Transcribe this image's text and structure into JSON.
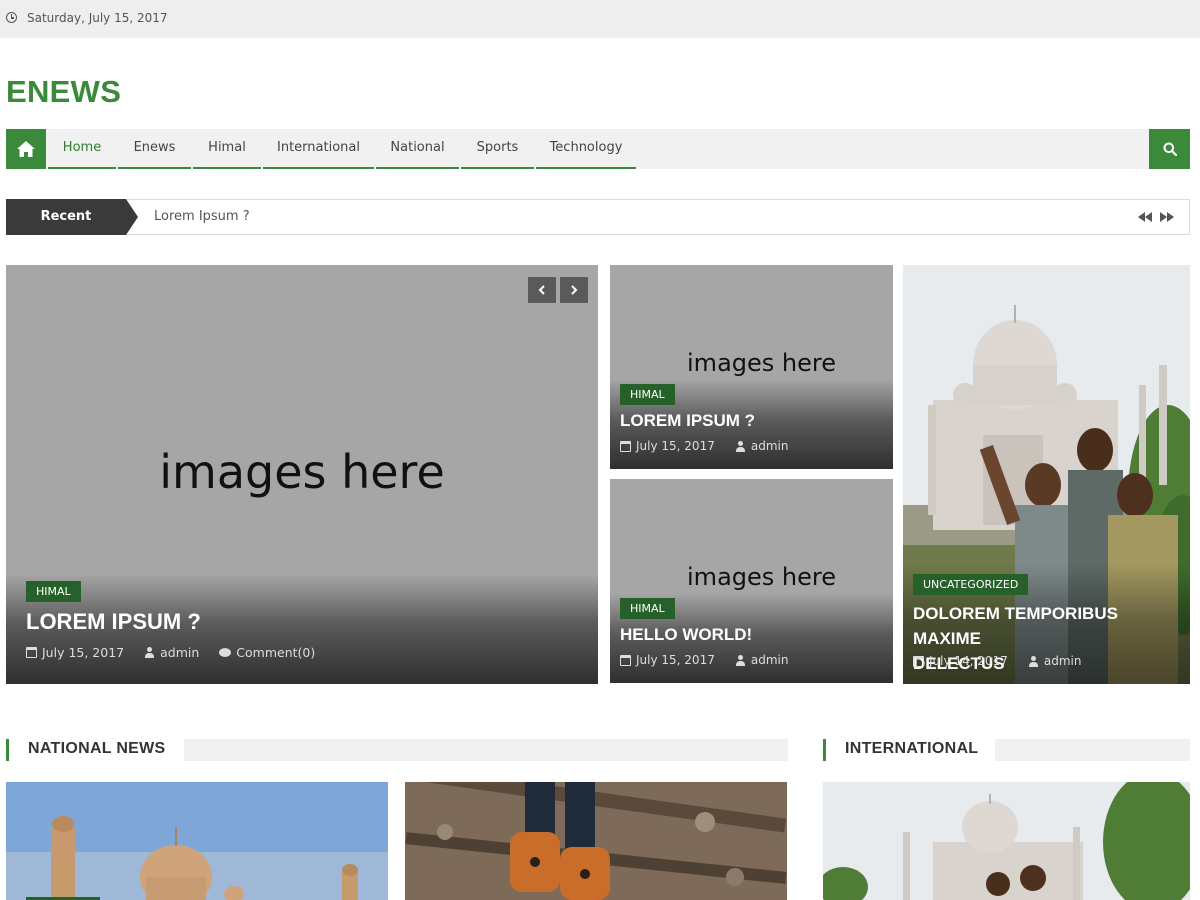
{
  "topbar": {
    "date": "Saturday, July 15, 2017",
    "icon": "clock-icon"
  },
  "site": {
    "logo": "ENEWS",
    "accent": "#3a8a3a",
    "badge_color": "#27612a"
  },
  "nav": {
    "items": [
      "Home",
      "Enews",
      "Himal",
      "International",
      "National",
      "Sports",
      "Technology"
    ],
    "active": "Home"
  },
  "ticker": {
    "label": "Recent",
    "text": "Lorem Ipsum ?"
  },
  "featured": {
    "main": {
      "placeholder": "images here",
      "category": "HIMAL",
      "title": "LOREM IPSUM ?",
      "date": "July 15, 2017",
      "author": "admin",
      "comments": "Comment(0)"
    },
    "small1": {
      "placeholder": "images here",
      "category": "HIMAL",
      "title": "LOREM IPSUM ?",
      "date": "July 15, 2017",
      "author": "admin"
    },
    "small2": {
      "placeholder": "images here",
      "category": "HIMAL",
      "title": "HELLO WORLD!",
      "date": "July 15, 2017",
      "author": "admin"
    },
    "tall": {
      "category": "UNCATEGORIZED",
      "title_line1": "DOLOREM TEMPORIBUS MAXIME",
      "title_line2": "DELECTUS",
      "date": "July 14, 2017",
      "author": "admin"
    }
  },
  "sections": {
    "national": "NATIONAL NEWS",
    "international": "INTERNATIONAL"
  }
}
